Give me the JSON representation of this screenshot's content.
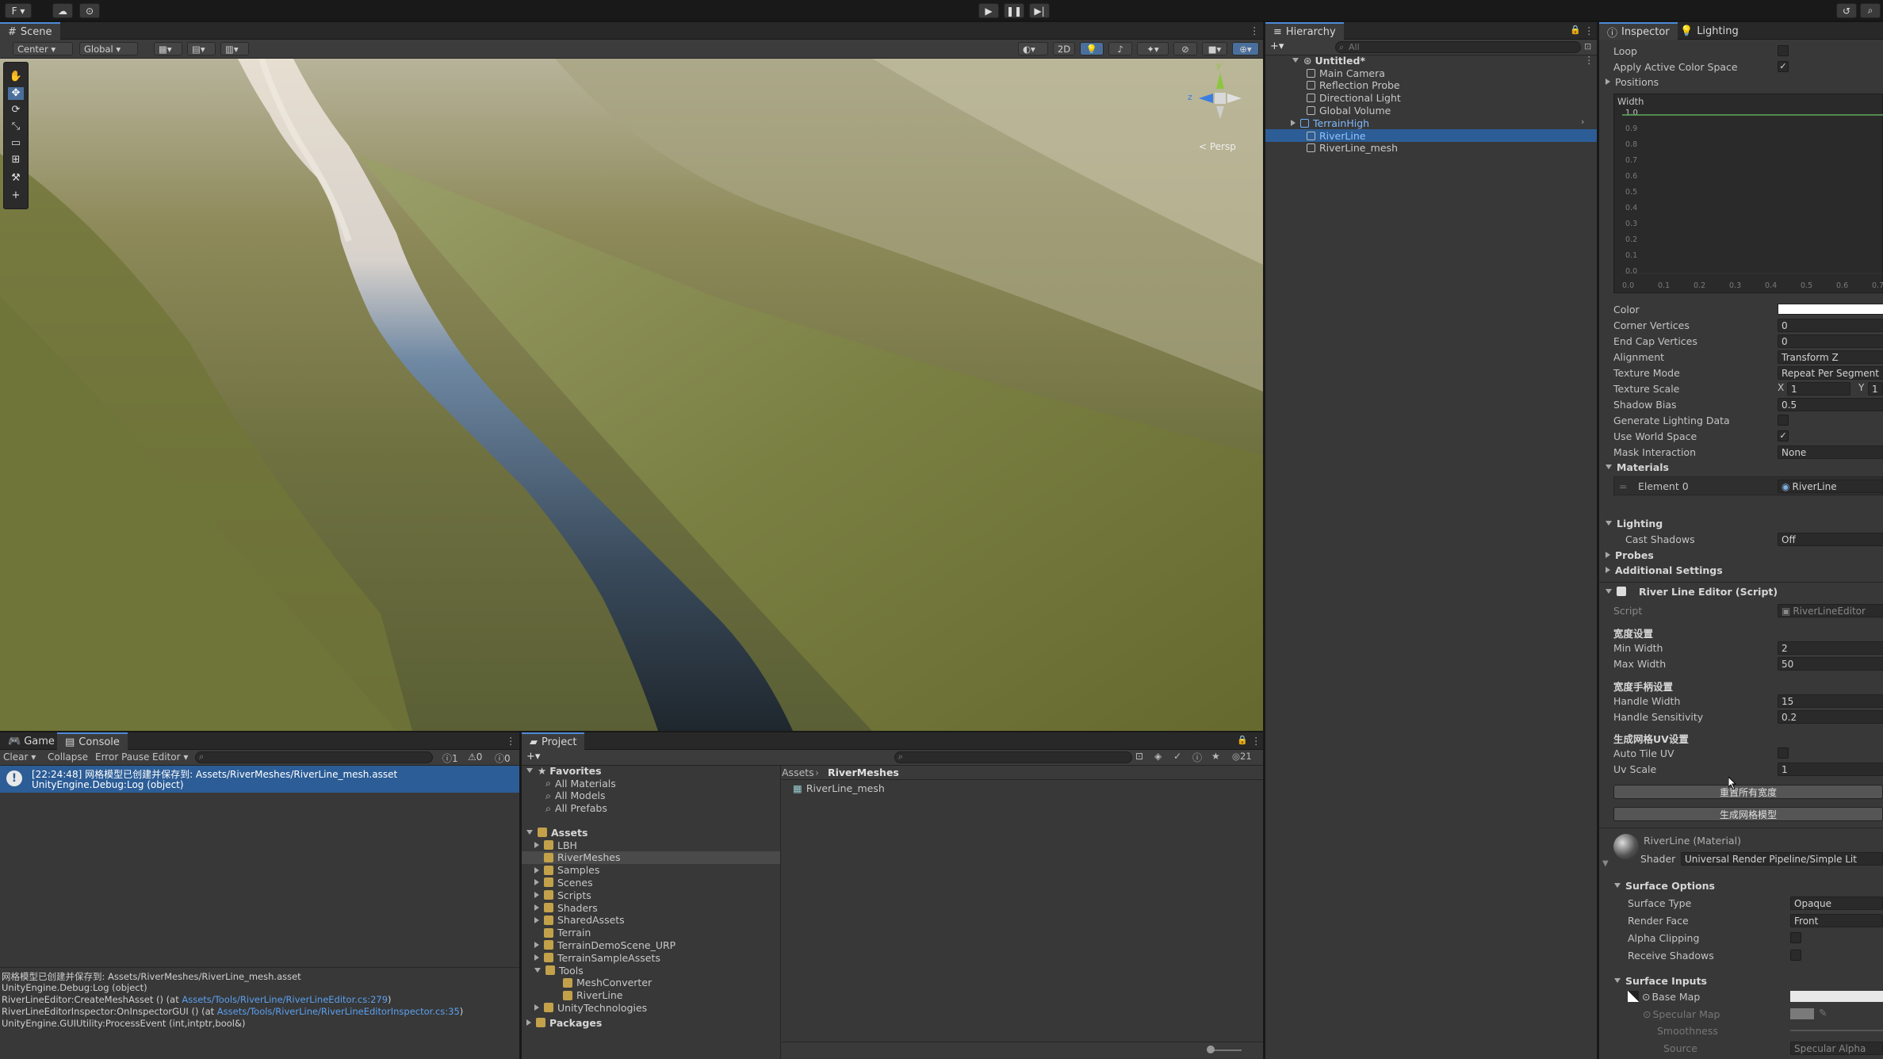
{
  "toolbar": {
    "account_label": "F ▾",
    "play_icon": "play-icon",
    "pause_icon": "pause-icon",
    "step_icon": "step-icon"
  },
  "scene": {
    "tab_label": "Scene",
    "pivot_label": "Center",
    "space_label": "Global",
    "mode_2d_label": "2D",
    "persp_label": "< Persp",
    "gizmo_y": "y",
    "gizmo_z": "z"
  },
  "hierarchy": {
    "tab_label": "Hierarchy",
    "search_placeholder": "All",
    "scene_name": "Untitled*",
    "items": [
      {
        "label": "Main Camera",
        "selected": false,
        "prefab": false
      },
      {
        "label": "Reflection Probe",
        "selected": false,
        "prefab": false
      },
      {
        "label": "Directional Light",
        "selected": false,
        "prefab": false
      },
      {
        "label": "Global Volume",
        "selected": false,
        "prefab": false
      },
      {
        "label": "TerrainHigh",
        "selected": false,
        "prefab": true
      },
      {
        "label": "RiverLine",
        "selected": true,
        "prefab": false
      },
      {
        "label": "RiverLine_mesh",
        "selected": false,
        "prefab": false
      }
    ]
  },
  "inspector": {
    "tab_inspector": "Inspector",
    "tab_lighting": "Lighting",
    "loop_label": "Loop",
    "apply_color_space_label": "Apply Active Color Space",
    "positions_label": "Positions",
    "width_curve": {
      "label": "Width",
      "top_value": "1.0",
      "y_ticks": [
        "0.9",
        "0.8",
        "0.7",
        "0.6",
        "0.5",
        "0.4",
        "0.3",
        "0.2",
        "0.1",
        "0.0"
      ],
      "x_ticks": [
        "0.0",
        "0.1",
        "0.2",
        "0.3",
        "0.4",
        "0.5",
        "0.6",
        "0.7"
      ]
    },
    "fields": [
      {
        "label": "Color",
        "value": "",
        "kind": "color"
      },
      {
        "label": "Corner Vertices",
        "value": "0",
        "kind": "text"
      },
      {
        "label": "End Cap Vertices",
        "value": "0",
        "kind": "text"
      },
      {
        "label": "Alignment",
        "value": "Transform Z",
        "kind": "dropdown"
      },
      {
        "label": "Texture Mode",
        "value": "Repeat Per Segment",
        "kind": "dropdown"
      },
      {
        "label": "Texture Scale",
        "value": "",
        "kind": "xy"
      },
      {
        "label": "Shadow Bias",
        "value": "0.5",
        "kind": "text"
      },
      {
        "label": "Generate Lighting Data",
        "value": "",
        "kind": "check-off"
      },
      {
        "label": "Use World Space",
        "value": "✓",
        "kind": "check-on"
      },
      {
        "label": "Mask Interaction",
        "value": "None",
        "kind": "dropdown"
      }
    ],
    "texture_scale": {
      "x_label": "X",
      "x_value": "1",
      "y_label": "Y",
      "y_value": "1"
    },
    "materials_label": "Materials",
    "element0_label": "Element 0",
    "element0_value": "RiverLine",
    "lighting_label": "Lighting",
    "cast_shadows_label": "Cast Shadows",
    "cast_shadows_value": "Off",
    "probes_label": "Probes",
    "additional_settings_label": "Additional Settings",
    "script_component_label": "River Line Editor (Script)",
    "script_label": "Script",
    "script_value": "RiverLineEditor",
    "width_section": "宽度设置",
    "min_width_label": "Min Width",
    "min_width_value": "2",
    "max_width_label": "Max Width",
    "max_width_value": "50",
    "handle_section": "宽度手柄设置",
    "handle_width_label": "Handle Width",
    "handle_width_value": "15",
    "handle_sensitivity_label": "Handle Sensitivity",
    "handle_sensitivity_value": "0.2",
    "uv_section": "生成网格UV设置",
    "auto_tile_uv_label": "Auto Tile UV",
    "uv_scale_label": "Uv Scale",
    "uv_scale_value": "1",
    "reset_width_button": "重置所有宽度",
    "generate_mesh_button": "生成网格模型",
    "material_title": "RiverLine (Material)",
    "shader_label": "Shader",
    "shader_value": "Universal Render Pipeline/Simple Lit",
    "surface_options_label": "Surface Options",
    "surface_type_label": "Surface Type",
    "surface_type_value": "Opaque",
    "render_face_label": "Render Face",
    "render_face_value": "Front",
    "alpha_clipping_label": "Alpha Clipping",
    "receive_shadows_label": "Receive Shadows",
    "surface_inputs_label": "Surface Inputs",
    "base_map_label": "Base Map",
    "specular_map_label": "Specular Map",
    "smoothness_label": "Smoothness",
    "source_label": "Source",
    "source_value": "Specular Alpha"
  },
  "console": {
    "tab_game": "Game",
    "tab_console": "Console",
    "clear_label": "Clear",
    "collapse_label": "Collapse",
    "error_pause_label": "Error Pause",
    "editor_label": "Editor",
    "count_info": "1",
    "count_warn": "0",
    "count_error": "0",
    "entry_line1": "[22:24:48] 网格模型已创建并保存到: Assets/RiverMeshes/RiverLine_mesh.asset",
    "entry_line2": "UnityEngine.Debug:Log (object)",
    "detail_lines": [
      {
        "text": "网格模型已创建并保存到: Assets/RiverMeshes/RiverLine_mesh.asset",
        "link": ""
      },
      {
        "text": "UnityEngine.Debug:Log (object)",
        "link": ""
      },
      {
        "text": "RiverLineEditor:CreateMeshAsset () (at ",
        "link": "Assets/Tools/RiverLine/RiverLineEditor.cs:279",
        "tail": ")"
      },
      {
        "text": "RiverLineEditorInspector:OnInspectorGUI () (at ",
        "link": "Assets/Tools/RiverLine/RiverLineEditorInspector.cs:35",
        "tail": ")"
      },
      {
        "text": "UnityEngine.GUIUtility:ProcessEvent (int,intptr,bool&)",
        "link": ""
      }
    ]
  },
  "project": {
    "tab_label": "Project",
    "hidden_count": "21",
    "favorites_label": "Favorites",
    "favorites": [
      "All Materials",
      "All Models",
      "All Prefabs"
    ],
    "assets_label": "Assets",
    "assets": [
      {
        "label": "LBH",
        "expandable": true,
        "selected": false,
        "depth": 1
      },
      {
        "label": "RiverMeshes",
        "expandable": false,
        "selected": true,
        "depth": 1
      },
      {
        "label": "Samples",
        "expandable": true,
        "selected": false,
        "depth": 1
      },
      {
        "label": "Scenes",
        "expandable": true,
        "selected": false,
        "depth": 1
      },
      {
        "label": "Scripts",
        "expandable": true,
        "selected": false,
        "depth": 1
      },
      {
        "label": "Shaders",
        "expandable": true,
        "selected": false,
        "depth": 1
      },
      {
        "label": "SharedAssets",
        "expandable": true,
        "selected": false,
        "depth": 1
      },
      {
        "label": "Terrain",
        "expandable": false,
        "selected": false,
        "depth": 1
      },
      {
        "label": "TerrainDemoScene_URP",
        "expandable": true,
        "selected": false,
        "depth": 1
      },
      {
        "label": "TerrainSampleAssets",
        "expandable": true,
        "selected": false,
        "depth": 1
      },
      {
        "label": "Tools",
        "expandable": true,
        "selected": false,
        "depth": 1
      },
      {
        "label": "MeshConverter",
        "expandable": false,
        "selected": false,
        "depth": 2
      },
      {
        "label": "RiverLine",
        "expandable": false,
        "selected": false,
        "depth": 2
      },
      {
        "label": "UnityTechnologies",
        "expandable": true,
        "selected": false,
        "depth": 1
      }
    ],
    "packages_label": "Packages",
    "breadcrumb_root": "Assets",
    "breadcrumb_leaf": "RiverMeshes",
    "file_label": "RiverLine_mesh"
  },
  "colors": {
    "accent": "#2c5d96",
    "link": "#5aa0f0"
  }
}
